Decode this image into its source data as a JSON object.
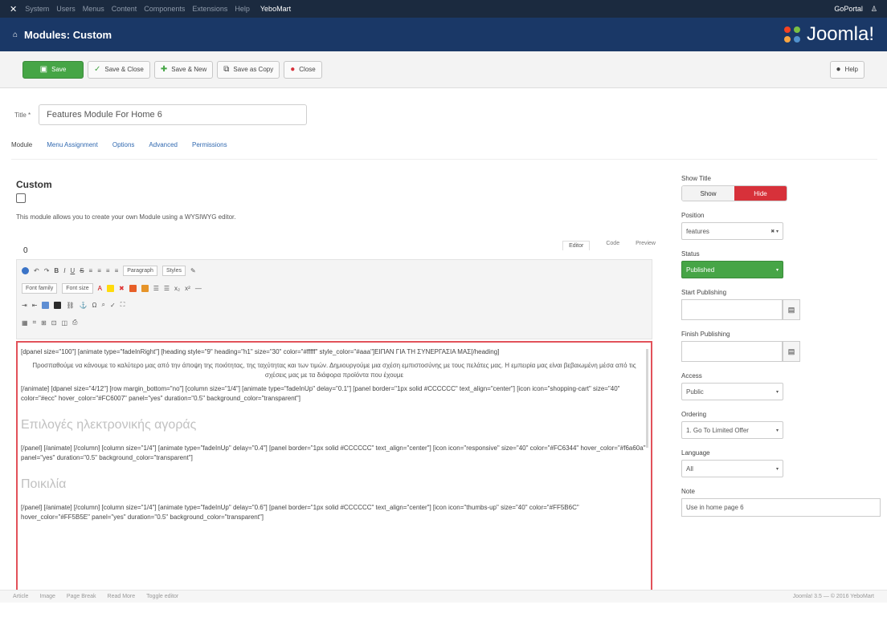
{
  "topnav": {
    "items": [
      "System",
      "Users",
      "Menus",
      "Content",
      "Components",
      "Extensions",
      "Help"
    ],
    "site_name": "YeboMart",
    "user": "GoPortal",
    "user_icon": "user-icon"
  },
  "header": {
    "title": "Modules: Custom",
    "brand": "Joomla!"
  },
  "toolbar": {
    "save_label": "Save",
    "save_close_label": "Save & Close",
    "save_new_label": "Save & New",
    "save_copy_label": "Save as Copy",
    "close_label": "Close",
    "help_label": "Help"
  },
  "title_field": {
    "label": "Title *",
    "value": "Features Module For Home 6"
  },
  "tabs": [
    "Module",
    "Menu Assignment",
    "Options",
    "Advanced",
    "Permissions"
  ],
  "module": {
    "heading": "Custom",
    "description": "This module allows you to create your own Module using a WYSIWYG editor."
  },
  "editor": {
    "label": "0",
    "view_tabs": [
      "Editor",
      "Code",
      "Preview"
    ],
    "format_select": "Paragraph",
    "styles_select": "Styles",
    "font_family_select": "Font family",
    "font_size_select": "Font size",
    "content": [
      {
        "style": "code",
        "text": "[dpanel size=\"100\"] [animate type=\"fadeInRight\"] [heading style=\"9\" heading=\"h1\" size=\"30\" color=\"#fffff\" style_color=\"#aaa\"]ΕΙΠΑΝ ΓΙΑ ΤΗ ΣΥΝΕΡΓΑΣΙΑ ΜΑΣ[/heading]"
      },
      {
        "style": "center",
        "text": "Προσπαθούμε να κάνουμε το καλύτερο μας από την άποψη της ποιότητας, της ταχύτητας και των τιμών. Δημιουργούμε μια σχέση εμπιστοσύνης με τους πελάτες μας. Η εμπειρία μας είναι βεβαιωμένη μέσα από τις σχέσεις μας με τα διάφορα προϊόντα που έχουμε"
      },
      {
        "style": "code",
        "text": "[/animate] [dpanel size=\"4/12\"] [row margin_bottom=\"no\"] [column size=\"1/4\"] [animate type=\"fadeInUp\" delay=\"0.1\"] [panel border=\"1px solid #CCCCCC\" text_align=\"center\"] [icon icon=\"shopping-cart\" size=\"40\" color=\"#ecc\" hover_color=\"#FC6007\" panel=\"yes\" duration=\"0.5\" background_color=\"transparent\"]"
      },
      {
        "style": "gk",
        "text": "Επιλογές ηλεκτρονικής αγοράς"
      },
      {
        "style": "code",
        "text": "[/panel] [/animate] [/column] [column size=\"1/4\"] [animate type=\"fadeInUp\" delay=\"0.4\"] [panel border=\"1px solid #CCCCCC\" text_align=\"center\"] [icon icon=\"responsive\" size=\"40\" color=\"#FC6344\" hover_color=\"#f6a60a\" panel=\"yes\" duration=\"0.5\" background_color=\"transparent\"]"
      },
      {
        "style": "gk",
        "text": "Ποικιλία"
      },
      {
        "style": "code",
        "text": "[/panel] [/animate] [/column] [column size=\"1/4\"] [animate type=\"fadeInUp\" delay=\"0.6\"] [panel border=\"1px solid #CCCCCC\" text_align=\"center\"] [icon icon=\"thumbs-up\" size=\"40\" color=\"#FF5B6C\" hover_color=\"#FF5B5E\" panel=\"yes\" duration=\"0.5\" background_color=\"transparent\"]"
      }
    ],
    "status_items": [
      "Article",
      "Image",
      "Page Break",
      "Read More",
      "Toggle editor"
    ],
    "status_right": "Joomla! 3.5 — © 2016 YeboMart"
  },
  "sidebar": {
    "show_title_label": "Show Title",
    "show_label": "Show",
    "hide_label": "Hide",
    "position_label": "Position",
    "position_value": "features",
    "status_label": "Status",
    "status_value": "Published",
    "start_publishing_label": "Start Publishing",
    "finish_publishing_label": "Finish Publishing",
    "access_label": "Access",
    "access_value": "Public",
    "ordering_label": "Ordering",
    "ordering_value": "1. Go To Limited Offer",
    "language_label": "Language",
    "language_value": "All",
    "note_label": "Note",
    "note_value": "Use in home page 6"
  },
  "colors": {
    "topnav": "#1b2a3f",
    "header": "#1a3867",
    "save_green": "#46a546",
    "hide_red": "#d7313a",
    "highlight_border": "#e2525a"
  }
}
